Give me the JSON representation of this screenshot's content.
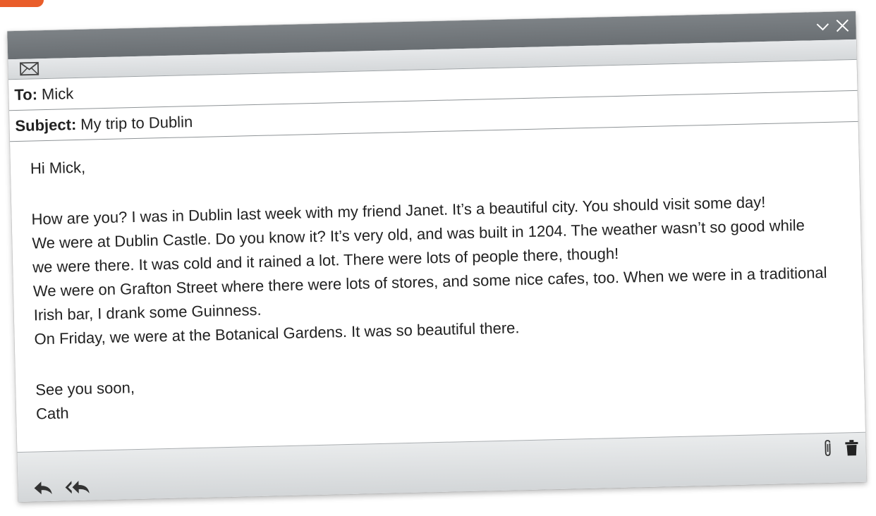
{
  "email": {
    "to_label": "To:",
    "to_value": "Mick",
    "subject_label": "Subject:",
    "subject_value": "My trip to Dublin",
    "greeting": "Hi Mick,",
    "paragraph_lines": [
      "How are you? I was in Dublin last week with my friend Janet. It’s a beautiful city. You should visit some day!",
      "We were at Dublin Castle. Do you know it? It’s very old, and was built in 1204. The weather wasn’t so good while",
      "we were there. It was cold and it rained a lot. There were lots of people there, though!",
      "We were on Grafton Street where there were lots of stores, and some nice cafes, too. When we were in a traditional",
      "Irish bar, I drank some Guinness.",
      "On Friday, we were at the Botanical Gardens. It was so beautiful there."
    ],
    "closing": "See you soon,",
    "signature": "Cath"
  },
  "icons": {
    "mail": "envelope-icon",
    "minimize": "chevron-down-icon",
    "close": "close-icon",
    "reply": "reply-icon",
    "reply_all": "reply-all-icon",
    "attach": "paperclip-icon",
    "delete": "trash-icon"
  },
  "colors": {
    "title_bar": "#6f7478",
    "corner_tab": "#e95d2a"
  }
}
